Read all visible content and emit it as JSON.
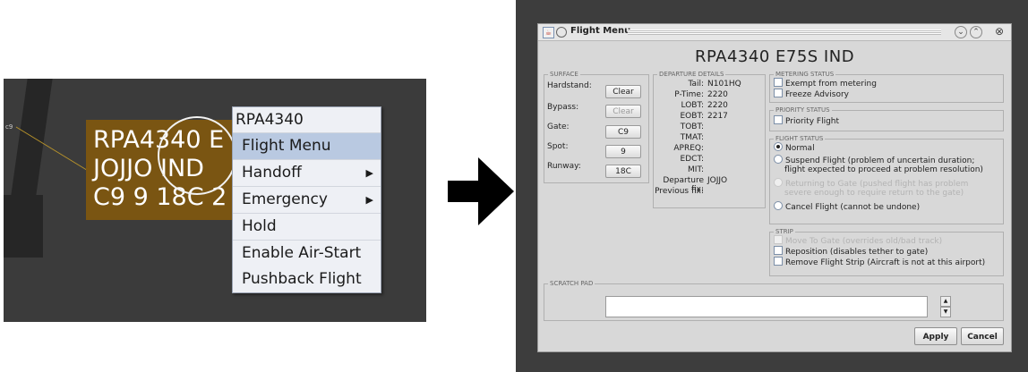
{
  "left": {
    "fix_label": "c9",
    "datablock": {
      "line1": "RPA4340 E",
      "line2": "JOJJO IND",
      "line3": "C9 9 18C 2"
    },
    "context_menu": {
      "title": "RPA4340",
      "items": [
        {
          "label": "Flight Menu",
          "highlighted": true
        },
        {
          "label": "Handoff",
          "submenu": true
        },
        {
          "label": "Emergency",
          "submenu": true
        },
        {
          "label": "Hold"
        },
        {
          "label": "Enable Air-Start"
        },
        {
          "label": "Pushback Flight"
        }
      ]
    }
  },
  "window": {
    "title": "Flight Menu",
    "header": "RPA4340   E75S   IND",
    "surface": {
      "legend": "SURFACE",
      "rows": [
        {
          "label": "Hardstand:",
          "value": "Clear",
          "enabled": true
        },
        {
          "label": "Bypass:",
          "value": "Clear",
          "enabled": false
        },
        {
          "label": "Gate:",
          "value": "C9",
          "enabled": true
        },
        {
          "label": "Spot:",
          "value": "9",
          "enabled": true
        },
        {
          "label": "Runway:",
          "value": "18C",
          "enabled": true
        }
      ]
    },
    "departure": {
      "legend": "DEPARTURE DETAILS",
      "rows": [
        {
          "key": "Tail:",
          "value": "N101HQ"
        },
        {
          "key": "P-Time:",
          "value": "2220"
        },
        {
          "key": "LOBT:",
          "value": "2220"
        },
        {
          "key": "EOBT:",
          "value": "2217"
        },
        {
          "key": "TOBT:",
          "value": ""
        },
        {
          "key": "TMAT:",
          "value": ""
        },
        {
          "key": "APREQ:",
          "value": ""
        },
        {
          "key": "EDCT:",
          "value": ""
        },
        {
          "key": "MIT:",
          "value": ""
        },
        {
          "key": "Departure fix:",
          "value": "JOJJO"
        },
        {
          "key": "Previous fix:",
          "value": ""
        }
      ]
    },
    "metering": {
      "legend": "METERING STATUS",
      "options": [
        "Exempt from metering",
        "Freeze Advisory"
      ]
    },
    "priority": {
      "legend": "PRIORITY STATUS",
      "options": [
        "Priority Flight"
      ]
    },
    "flight_status": {
      "legend": "FLIGHT STATUS",
      "options": [
        {
          "label": "Normal",
          "selected": true,
          "enabled": true
        },
        {
          "label": "Suspend Flight (problem of uncertain duration;",
          "label2": "flight expected to proceed at problem resolution)",
          "enabled": true
        },
        {
          "label": "Returning to Gate (pushed flight has problem",
          "label2": "severe enough to require return to the gate)",
          "enabled": false
        },
        {
          "label": "Cancel Flight (cannot be undone)",
          "enabled": true
        }
      ]
    },
    "strip": {
      "legend": "STRIP",
      "options": [
        {
          "label": "Move To Gate (overrides old/bad track)",
          "enabled": false
        },
        {
          "label": "Reposition (disables tether to gate)",
          "enabled": true
        },
        {
          "label": "Remove Flight Strip (Aircraft is not at this airport)",
          "enabled": true
        }
      ]
    },
    "scratch_pad": {
      "legend": "SCRATCH PAD",
      "value": ""
    },
    "buttons": {
      "apply": "Apply",
      "cancel": "Cancel"
    }
  },
  "colors": {
    "datablock": "#7a5512",
    "menu_highlight": "#b9c9e1",
    "map_bg": "#3b3b3b"
  },
  "icons": [
    "java-cup-icon",
    "window-circle-icon",
    "minimize-icon",
    "maximize-icon",
    "close-icon",
    "submenu-arrow-icon",
    "right-arrow-icon"
  ]
}
